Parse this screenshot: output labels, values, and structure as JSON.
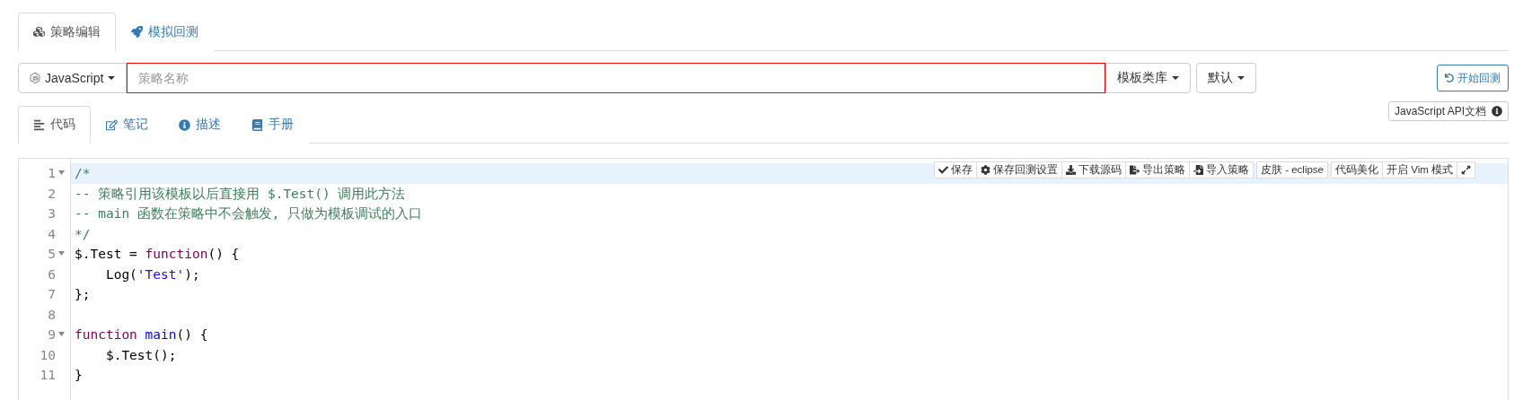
{
  "top_tabs": [
    {
      "label": "策略编辑",
      "selected": true
    },
    {
      "label": "模拟回测",
      "selected": false
    }
  ],
  "toolbar": {
    "language": "JavaScript",
    "name_field": {
      "placeholder": "策略名称",
      "invalid": true
    },
    "template_menu": "模板类库",
    "default_menu": "默认",
    "start_button": "开始回测"
  },
  "editor_tabs": [
    {
      "label": "代码",
      "selected": true
    },
    {
      "label": "笔记",
      "selected": false
    },
    {
      "label": "描述",
      "selected": false
    },
    {
      "label": "手册",
      "selected": false
    }
  ],
  "api_doc_button": "JavaScript API文档",
  "editor_toolbar": [
    {
      "kind": "text",
      "label": "保存"
    },
    {
      "kind": "text",
      "label": "保存回测设置"
    },
    {
      "kind": "text",
      "label": "下载源码"
    },
    {
      "kind": "text",
      "label": "导出策略"
    },
    {
      "kind": "text",
      "label": "导入策略"
    },
    {
      "kind": "text",
      "label": "皮肤 - eclipse"
    },
    {
      "kind": "text",
      "label": "代码美化"
    },
    {
      "kind": "text",
      "label": "开启 Vim 模式"
    },
    {
      "kind": "icon"
    }
  ],
  "code_lines": [
    {
      "number": "1",
      "foldable": true,
      "selected": true,
      "tokens": [
        {
          "kind": "comment",
          "text": "/*"
        }
      ]
    },
    {
      "number": "2",
      "foldable": false,
      "selected": false,
      "tokens": [
        {
          "kind": "comment",
          "text": "-- 策略引用该模板以后直接用 $.Test() 调用此方法"
        }
      ]
    },
    {
      "number": "3",
      "foldable": false,
      "selected": false,
      "tokens": [
        {
          "kind": "comment",
          "text": "-- main 函数在策略中不会触发, 只做为模板调试的入口"
        }
      ]
    },
    {
      "number": "4",
      "foldable": false,
      "selected": false,
      "tokens": [
        {
          "kind": "comment",
          "text": "*/"
        }
      ]
    },
    {
      "number": "5",
      "foldable": true,
      "selected": false,
      "tokens": [
        {
          "kind": "plain",
          "text": "$.Test = "
        },
        {
          "kind": "keyword",
          "text": "function"
        },
        {
          "kind": "plain",
          "text": "() {"
        }
      ]
    },
    {
      "number": "6",
      "foldable": false,
      "selected": false,
      "tokens": [
        {
          "kind": "plain",
          "text": "    Log("
        },
        {
          "kind": "string",
          "text": "'Test'"
        },
        {
          "kind": "plain",
          "text": ");"
        }
      ]
    },
    {
      "number": "7",
      "foldable": false,
      "selected": false,
      "tokens": [
        {
          "kind": "plain",
          "text": "};"
        }
      ]
    },
    {
      "number": "8",
      "foldable": false,
      "selected": false
    },
    {
      "number": "9",
      "foldable": true,
      "selected": false,
      "tokens": [
        {
          "kind": "keyword",
          "text": "function "
        },
        {
          "kind": "func",
          "text": "main"
        },
        {
          "kind": "plain",
          "text": "() {"
        }
      ]
    },
    {
      "number": "10",
      "foldable": false,
      "selected": false,
      "tokens": [
        {
          "kind": "plain",
          "text": "    $.Test();"
        }
      ]
    },
    {
      "number": "11",
      "foldable": false,
      "selected": false,
      "tokens": [
        {
          "kind": "plain",
          "text": "}"
        }
      ]
    }
  ]
}
